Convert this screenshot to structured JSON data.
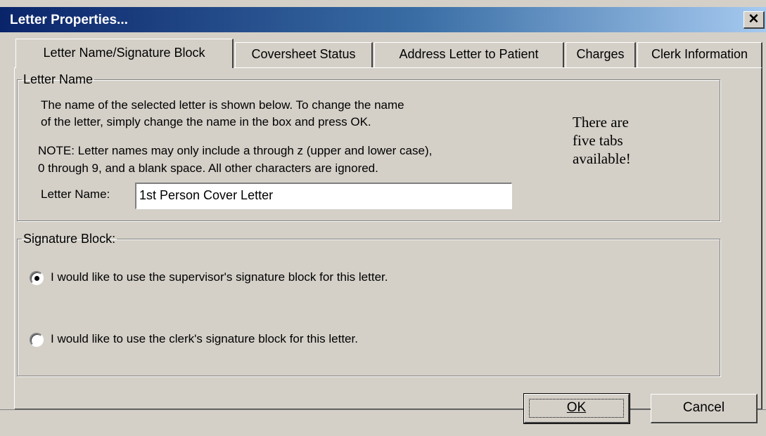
{
  "window": {
    "title": "Letter Properties...",
    "close_glyph": "✕"
  },
  "tabs": [
    {
      "label": "Letter Name/Signature  Block",
      "active": true
    },
    {
      "label": "Coversheet Status",
      "active": false
    },
    {
      "label": "Address Letter to Patient",
      "active": false
    },
    {
      "label": "Charges",
      "active": false
    },
    {
      "label": "Clerk Information",
      "active": false
    }
  ],
  "letter_name_group": {
    "legend": "Letter Name",
    "desc_line1": "The name of the selected letter is shown below.  To change the name",
    "desc_line2": "of the letter, simply change the name in the box  and press OK.",
    "note_line1": "NOTE: Letter names may only include a through z (upper and lower case),",
    "note_line2": "0 through 9, and a blank space.  All other characters are ignored.",
    "field_label": "Letter Name:",
    "field_value": "1st Person Cover Letter"
  },
  "annotation": {
    "line1": "There are",
    "line2": "five tabs",
    "line3": "available!"
  },
  "signature_group": {
    "legend": "Signature Block:",
    "options": [
      {
        "label": "I would like to use the supervisor's signature block for this letter.",
        "selected": true
      },
      {
        "label": "I would like to use the clerk's signature block for this letter.",
        "selected": false
      }
    ]
  },
  "buttons": {
    "ok": {
      "label": "OK"
    },
    "cancel": {
      "label": "Cancel"
    }
  }
}
